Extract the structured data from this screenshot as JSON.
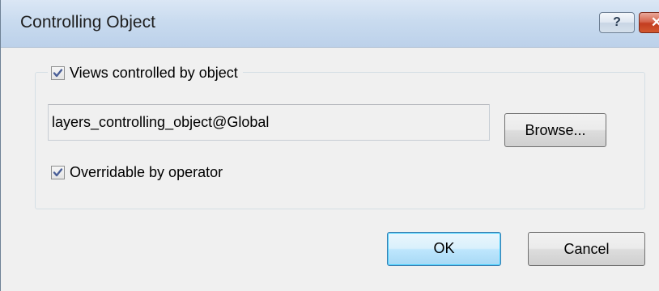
{
  "window": {
    "title": "Controlling Object",
    "help_glyph": "?",
    "close_glyph": "✕"
  },
  "group": {
    "checkbox_label": "Views controlled by object",
    "checkbox_checked": true
  },
  "object_field": {
    "value": "layers_controlling_object@Global"
  },
  "browse_button": {
    "label": "Browse..."
  },
  "overridable": {
    "label": "Overridable by operator",
    "checked": true
  },
  "footer": {
    "ok_label": "OK",
    "cancel_label": "Cancel"
  },
  "colors": {
    "checkmark": "#4a5f97",
    "titlebar": "#c9dbef",
    "close_button": "#c33d20",
    "dialog_background": "#f0f0f0"
  }
}
